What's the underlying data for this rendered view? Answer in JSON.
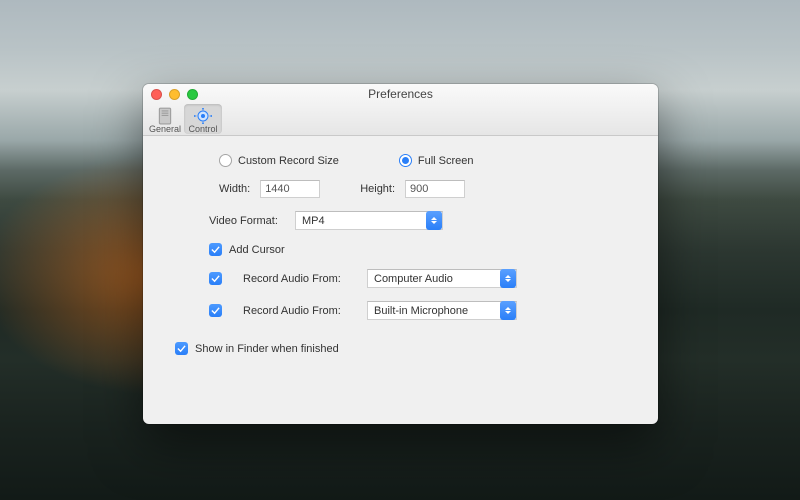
{
  "window": {
    "title": "Preferences"
  },
  "toolbar": {
    "general": "General",
    "control": "Control"
  },
  "recordMode": {
    "customLabel": "Custom Record Size",
    "fullLabel": "Full Screen",
    "selected": "full"
  },
  "dims": {
    "widthLabel": "Width:",
    "widthValue": "1440",
    "heightLabel": "Height:",
    "heightValue": "900"
  },
  "format": {
    "label": "Video Format:",
    "value": "MP4"
  },
  "cursor": {
    "label": "Add Cursor"
  },
  "audio1": {
    "label": "Record Audio From:",
    "value": "Computer Audio"
  },
  "audio2": {
    "label": "Record Audio From:",
    "value": "Built-in Microphone"
  },
  "finder": {
    "label": "Show in Finder when finished"
  }
}
